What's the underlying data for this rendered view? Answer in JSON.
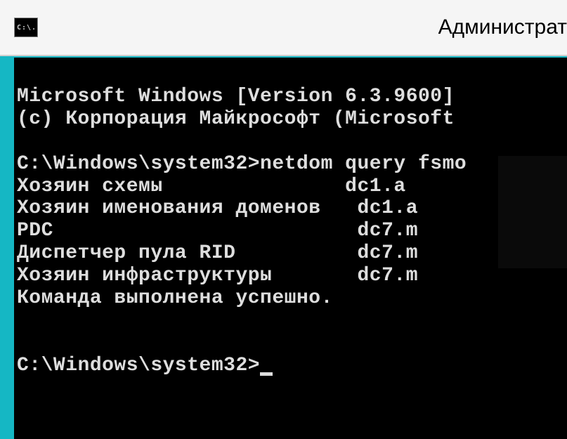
{
  "window": {
    "title": "Администрат",
    "icon_text": "C:\\."
  },
  "terminal": {
    "lines": [
      "Microsoft Windows [Version 6.3.9600]",
      "(c) Корпорация Майкрософт (Microsoft ",
      "",
      "C:\\Windows\\system32>netdom query fsmo",
      "Хозяин схемы               dc1.a",
      "Хозяин именования доменов   dc1.a",
      "PDC                         dc7.m",
      "Диспетчер пула RID          dc7.m",
      "Хозяин инфраструктуры       dc7.m",
      "Команда выполнена успешно.",
      "",
      "",
      "C:\\Windows\\system32>"
    ],
    "prompt": "C:\\Windows\\system32>",
    "command": "netdom query fsmo",
    "fsmo_roles": [
      {
        "role": "Хозяин схемы",
        "server": "dc1.a"
      },
      {
        "role": "Хозяин именования доменов",
        "server": "dc1.a"
      },
      {
        "role": "PDC",
        "server": "dc7.m"
      },
      {
        "role": "Диспетчер пула RID",
        "server": "dc7.m"
      },
      {
        "role": "Хозяин инфраструктуры",
        "server": "dc7.m"
      }
    ],
    "status": "Команда выполнена успешно."
  }
}
